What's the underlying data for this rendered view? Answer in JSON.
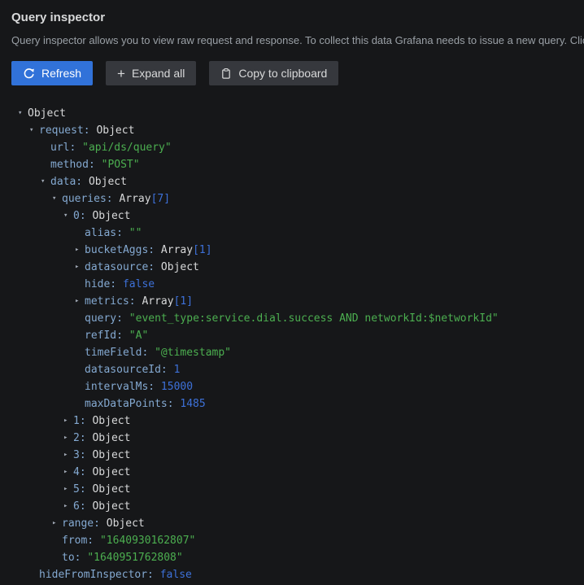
{
  "header": {
    "title": "Query inspector",
    "description": "Query inspector allows you to view raw request and response. To collect this data Grafana needs to issue a new query. Click refresh button below to trigger a new query."
  },
  "toolbar": {
    "refresh_label": "Refresh",
    "expand_all_label": "Expand all",
    "copy_label": "Copy to clipboard"
  },
  "icons": {
    "refresh": "sync-circular-arrow",
    "expand_all_glyph": "+",
    "copy": "clipboard",
    "expanded_glyph": "▾",
    "collapsed_glyph": "▸"
  },
  "colors": {
    "background": "#161719",
    "primary_button": "#3172d9",
    "secondary_button": "#36383d",
    "title_text": "#d8d9da",
    "description_text": "#9aa0a6",
    "json_key": "#84a9d1",
    "json_string": "#4caf50",
    "json_number": "#3d71d9",
    "json_object_label": "#d8d9da"
  },
  "tree": {
    "lines": [
      {
        "i": 0,
        "t": "o",
        "k": null,
        "v": "Object",
        "vt": "obj"
      },
      {
        "i": 1,
        "t": "o",
        "k": "request",
        "v": "Object",
        "vt": "obj"
      },
      {
        "i": 2,
        "t": null,
        "k": "url",
        "v": "\"api/ds/query\"",
        "vt": "str"
      },
      {
        "i": 2,
        "t": null,
        "k": "method",
        "v": "\"POST\"",
        "vt": "str"
      },
      {
        "i": 2,
        "t": "o",
        "k": "data",
        "v": "Object",
        "vt": "obj"
      },
      {
        "i": 3,
        "t": "o",
        "k": "queries",
        "v": "Array",
        "vt": "arr",
        "s": "[7]"
      },
      {
        "i": 4,
        "t": "o",
        "k": "0",
        "v": "Object",
        "vt": "obj"
      },
      {
        "i": 5,
        "t": null,
        "k": "alias",
        "v": "\"\"",
        "vt": "str"
      },
      {
        "i": 5,
        "t": "c",
        "k": "bucketAggs",
        "v": "Array",
        "vt": "arr",
        "s": "[1]"
      },
      {
        "i": 5,
        "t": "c",
        "k": "datasource",
        "v": "Object",
        "vt": "obj"
      },
      {
        "i": 5,
        "t": null,
        "k": "hide",
        "v": "false",
        "vt": "bool"
      },
      {
        "i": 5,
        "t": "c",
        "k": "metrics",
        "v": "Array",
        "vt": "arr",
        "s": "[1]"
      },
      {
        "i": 5,
        "t": null,
        "k": "query",
        "v": "\"event_type:service.dial.success AND networkId:$networkId\"",
        "vt": "str"
      },
      {
        "i": 5,
        "t": null,
        "k": "refId",
        "v": "\"A\"",
        "vt": "str"
      },
      {
        "i": 5,
        "t": null,
        "k": "timeField",
        "v": "\"@timestamp\"",
        "vt": "str"
      },
      {
        "i": 5,
        "t": null,
        "k": "datasourceId",
        "v": "1",
        "vt": "num"
      },
      {
        "i": 5,
        "t": null,
        "k": "intervalMs",
        "v": "15000",
        "vt": "num"
      },
      {
        "i": 5,
        "t": null,
        "k": "maxDataPoints",
        "v": "1485",
        "vt": "num"
      },
      {
        "i": 4,
        "t": "c",
        "k": "1",
        "v": "Object",
        "vt": "obj"
      },
      {
        "i": 4,
        "t": "c",
        "k": "2",
        "v": "Object",
        "vt": "obj"
      },
      {
        "i": 4,
        "t": "c",
        "k": "3",
        "v": "Object",
        "vt": "obj"
      },
      {
        "i": 4,
        "t": "c",
        "k": "4",
        "v": "Object",
        "vt": "obj"
      },
      {
        "i": 4,
        "t": "c",
        "k": "5",
        "v": "Object",
        "vt": "obj"
      },
      {
        "i": 4,
        "t": "c",
        "k": "6",
        "v": "Object",
        "vt": "obj"
      },
      {
        "i": 3,
        "t": "c",
        "k": "range",
        "v": "Object",
        "vt": "obj"
      },
      {
        "i": 3,
        "t": null,
        "k": "from",
        "v": "\"1640930162807\"",
        "vt": "str"
      },
      {
        "i": 3,
        "t": null,
        "k": "to",
        "v": "\"1640951762808\"",
        "vt": "str"
      },
      {
        "i": 1,
        "t": null,
        "k": "hideFromInspector",
        "v": "false",
        "vt": "bool"
      }
    ]
  }
}
